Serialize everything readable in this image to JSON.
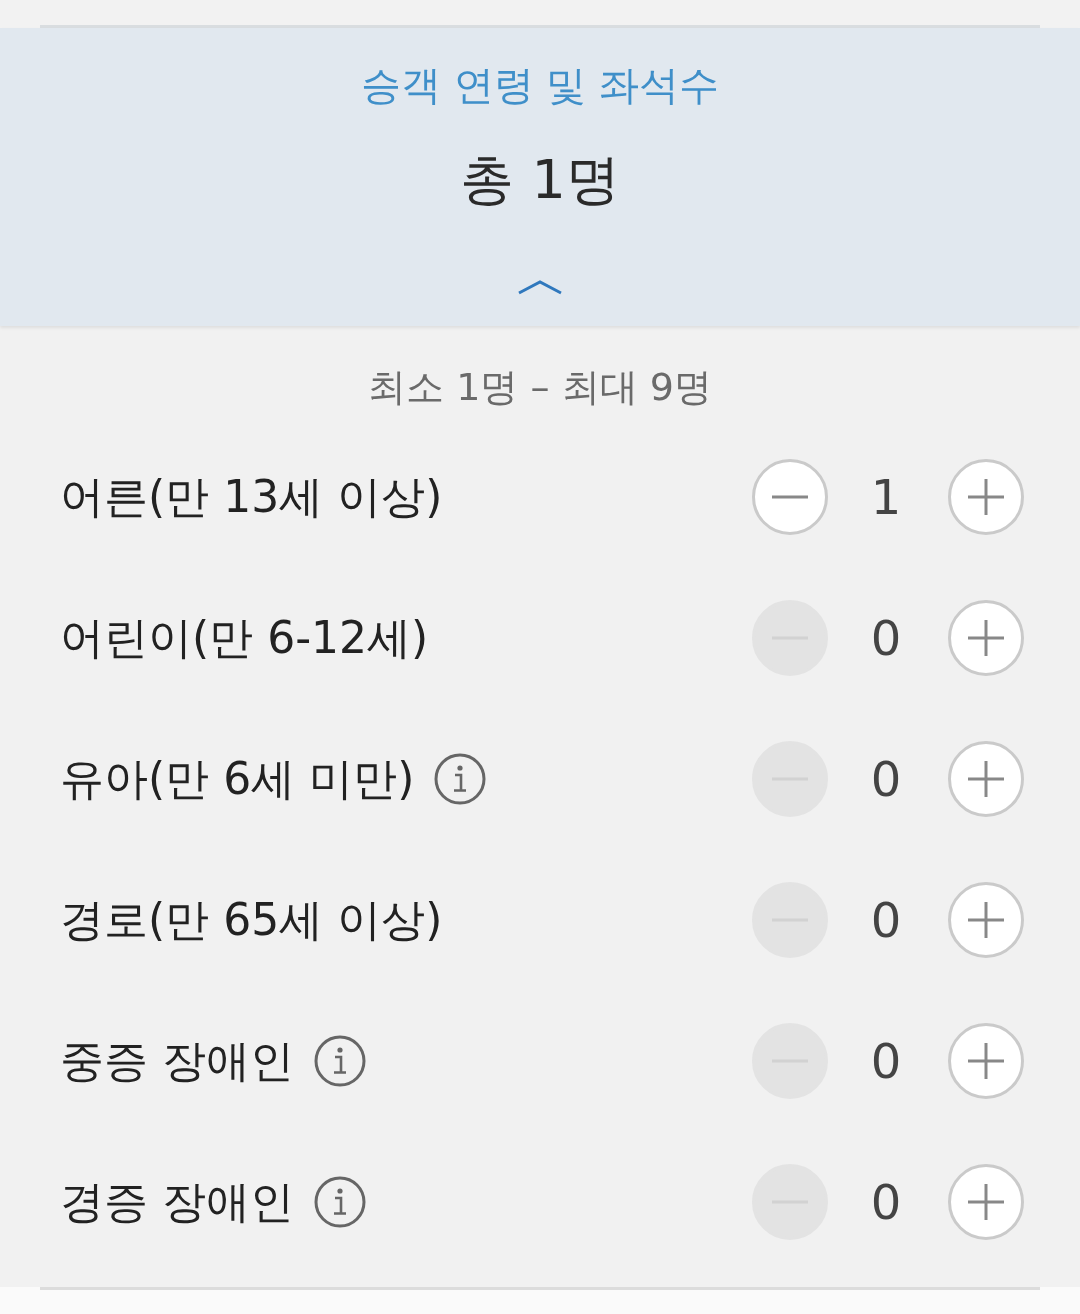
{
  "header": {
    "title": "승객 연령 및 좌석수",
    "total": "총 1명",
    "expanded": true
  },
  "range": "최소 1명 – 최대 9명",
  "passengers": [
    {
      "label": "어른(만 13세 이상)",
      "info": false,
      "count": "1",
      "minus_disabled": false,
      "plus_disabled": false
    },
    {
      "label": "어린이(만 6-12세)",
      "info": false,
      "count": "0",
      "minus_disabled": true,
      "plus_disabled": false
    },
    {
      "label": "유아(만 6세 미만)",
      "info": true,
      "count": "0",
      "minus_disabled": true,
      "plus_disabled": false
    },
    {
      "label": "경로(만 65세 이상)",
      "info": false,
      "count": "0",
      "minus_disabled": true,
      "plus_disabled": false
    },
    {
      "label": "중증 장애인",
      "info": true,
      "count": "0",
      "minus_disabled": true,
      "plus_disabled": false
    },
    {
      "label": "경증 장애인",
      "info": true,
      "count": "0",
      "minus_disabled": true,
      "plus_disabled": false
    }
  ]
}
